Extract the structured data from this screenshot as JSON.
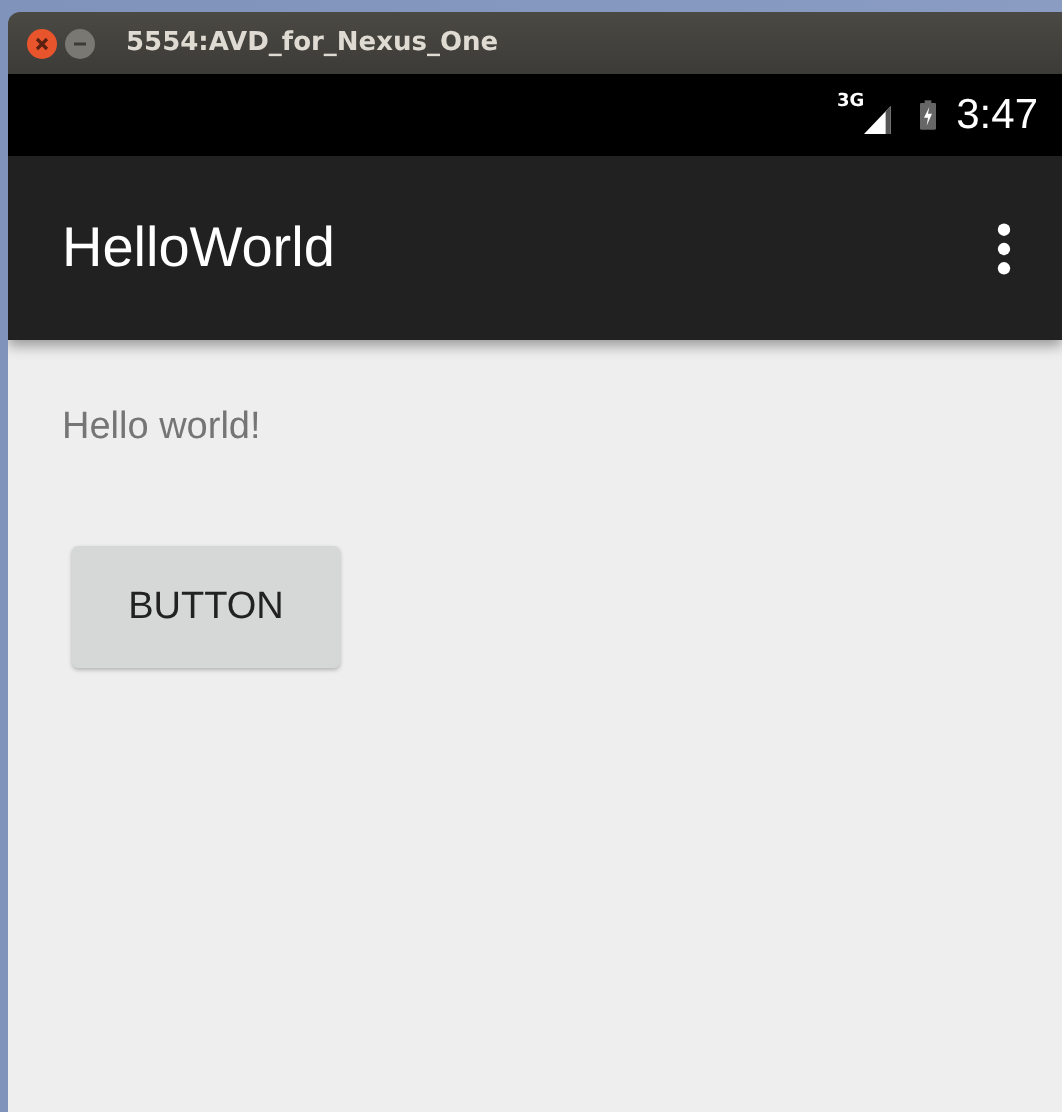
{
  "window": {
    "title": "5554:AVD_for_Nexus_One"
  },
  "status_bar": {
    "network": "3G",
    "time": "3:47"
  },
  "app_bar": {
    "title": "HelloWorld"
  },
  "content": {
    "text": "Hello world!",
    "button": "BUTTON"
  }
}
